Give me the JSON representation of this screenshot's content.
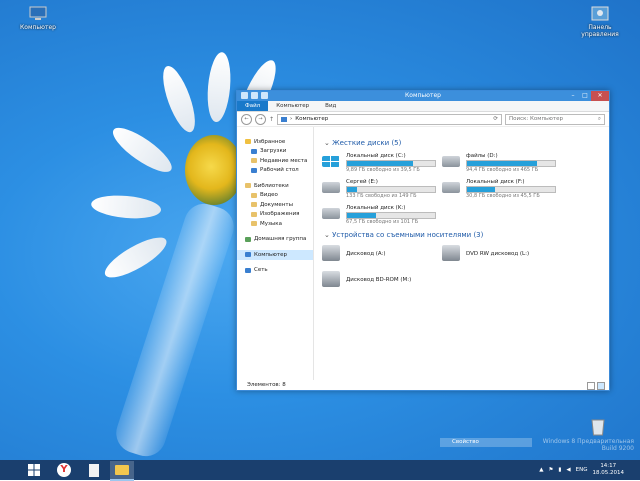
{
  "desktop": {
    "icons": [
      {
        "label": "Компьютер",
        "icon": "computer-icon"
      },
      {
        "label": "Панель управления",
        "icon": "control-panel-icon"
      }
    ],
    "watermark": [
      "Windows 8 Предварительная",
      "Build 9200"
    ],
    "properties_label": "Свойство"
  },
  "window": {
    "title": "Компьютер",
    "ribbon_tabs": [
      "Файл",
      "Компьютер",
      "Вид"
    ],
    "address": "Компьютер",
    "search_placeholder": "Поиск: Компьютер",
    "nav": {
      "favorites": "Избранное",
      "favorite_items": [
        "Загрузки",
        "Недавние места",
        "Рабочий стол"
      ],
      "libraries": "Библиотеки",
      "library_items": [
        "Видео",
        "Документы",
        "Изображения",
        "Музыка"
      ],
      "homegroup": "Домашняя группа",
      "computer": "Компьютер",
      "network": "Сеть"
    },
    "hdd_group": {
      "title": "Жесткие диски",
      "count": "(5)"
    },
    "drives": [
      {
        "name": "Локальный диск (C:)",
        "free": "9,89 ГБ свободно из 39,5 ГБ",
        "used_fraction": 0.75
      },
      {
        "name": "файлы (D:)",
        "free": "94,4 ГБ свободно из 465 ГБ",
        "used_fraction": 0.8
      },
      {
        "name": "Сергей (E:)",
        "free": "133 ГБ свободно из 149 ГБ",
        "used_fraction": 0.11
      },
      {
        "name": "Локальный диск (F:)",
        "free": "30,8 ГБ свободно из 45,5 ГБ",
        "used_fraction": 0.32
      },
      {
        "name": "Локальный диск (K:)",
        "free": "67,5 ГБ свободно из 101 ГБ",
        "used_fraction": 0.33
      }
    ],
    "removable_group": {
      "title": "Устройства со съемными носителями",
      "count": "(3)"
    },
    "devices": [
      {
        "name": "Дисковод (A:)"
      },
      {
        "name": "DVD RW дисковод (L:)"
      },
      {
        "name": "Дисковод BD-ROM (M:)"
      }
    ],
    "status": "Элементов: 8"
  },
  "taskbar": {
    "lang": "ENG",
    "time": "14:17",
    "date": "18.05.2014"
  }
}
